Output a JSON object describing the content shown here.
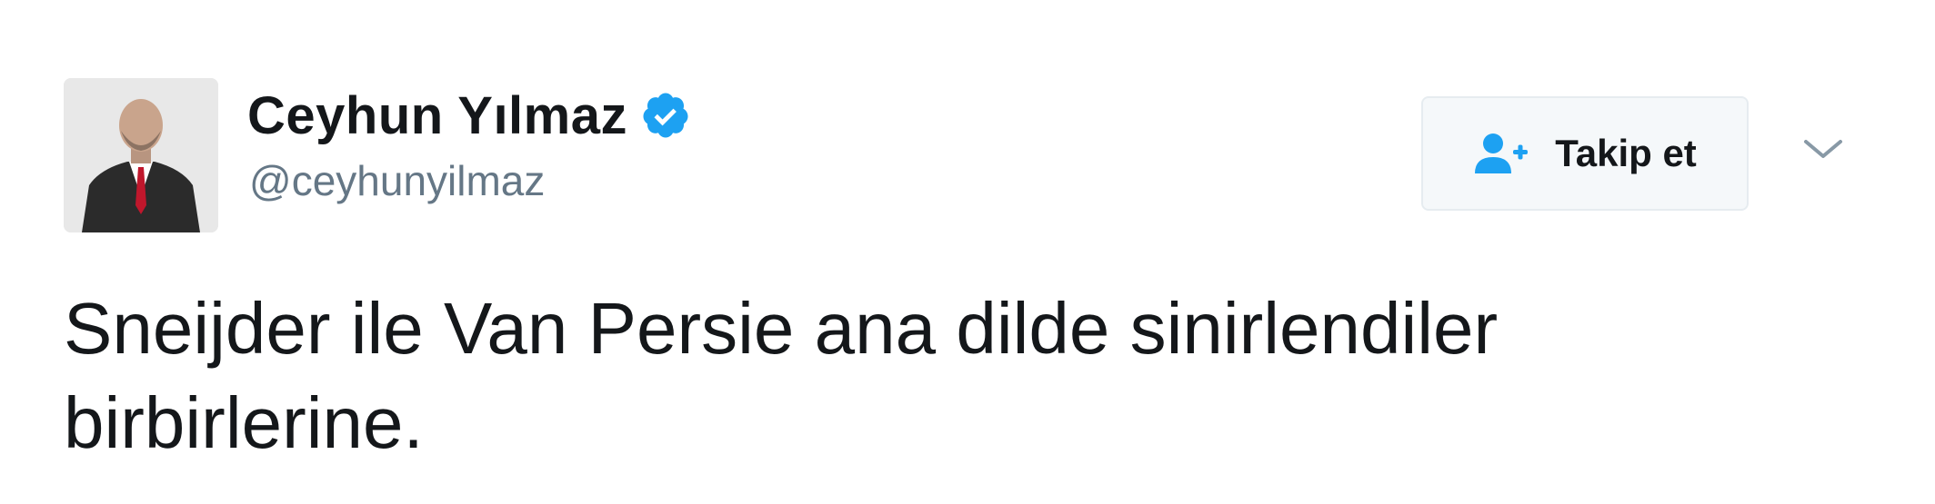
{
  "author": {
    "display_name": "Ceyhun Yılmaz",
    "screen_name": "@ceyhunyilmaz",
    "verified": true,
    "avatar_icon": "profile-photo-man-in-suit"
  },
  "actions": {
    "follow_label": "Takip et",
    "follow_icon": "add-user-icon",
    "more_icon": "chevron-down-icon"
  },
  "tweet": {
    "text": "Sneijder ile Van Persie ana dilde sinirlendiler\nbirbirlerine."
  },
  "colors": {
    "verified_blue": "#1da1f2",
    "follow_icon_blue": "#1da1f2",
    "screen_name_gray": "#657786",
    "button_bg": "#f5f8fa",
    "button_border": "#e6ecf0",
    "text": "#14171a"
  }
}
